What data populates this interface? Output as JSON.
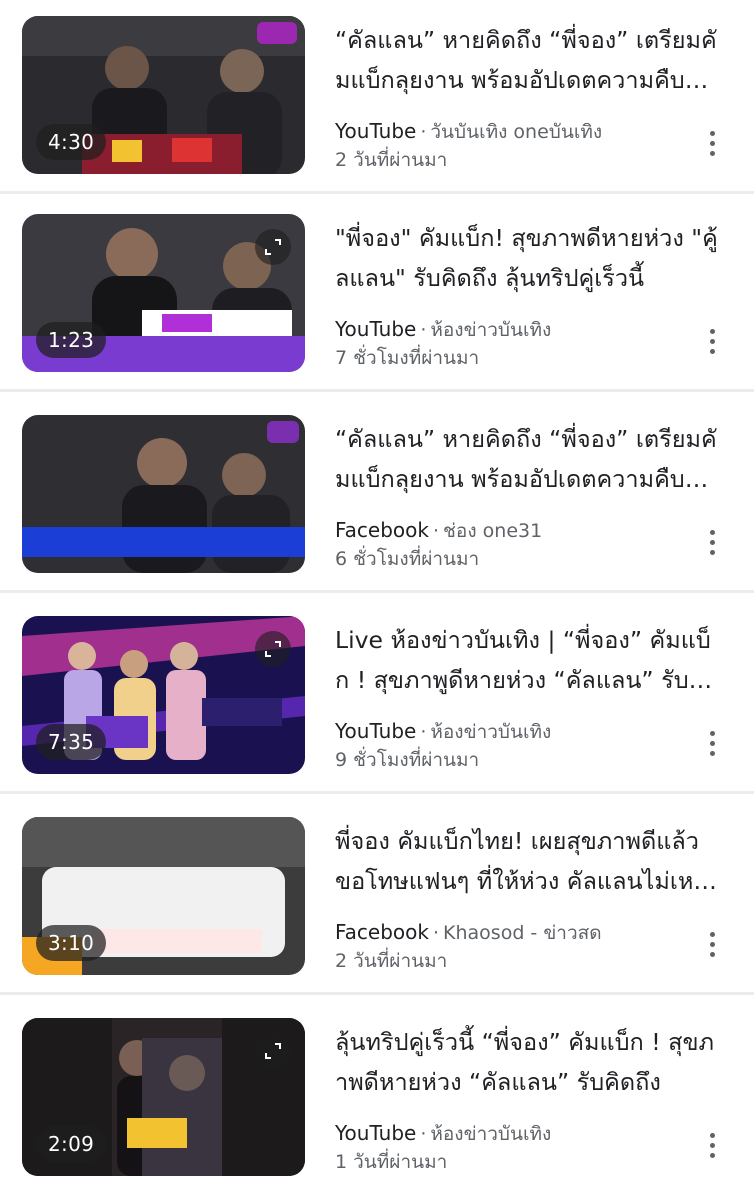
{
  "results": [
    {
      "title": "“คัลแลน” หายคิดถึง “พี่จอง” เตรียมคัมแบ็กลุยงาน พร้อมอัปเดตความคืบหน้า",
      "source": "YouTube",
      "channel": "วันบันเทิง oneบันเทิง",
      "time": "2 วันที่ผ่านมา",
      "duration": "4:30",
      "expand_icon": false,
      "thumb_colors": [
        "#2b2b2f",
        "#5a4d44",
        "#1c1c20"
      ]
    },
    {
      "title": "\"พี่จอง\" คัมแบ็ก! สุขภาพดีหายห่วง \"คู้ลแลน\" รับคิดถึง ลุ้นทริปคู่เร็วนี้",
      "source": "YouTube",
      "channel": "ห้องข่าวบันเทิง",
      "time": "7 ชั่วโมงที่ผ่านมา",
      "duration": "1:23",
      "expand_icon": true,
      "thumb_colors": [
        "#3a3a40",
        "#6b5f6a",
        "#7a3bd1"
      ]
    },
    {
      "title": "“คัลแลน” หายคิดถึง “พี่จอง” เตรียมคัมแบ็กลุยงาน พร้อมอัปเดตความคืบหน้า",
      "source": "Facebook",
      "channel": "ช่อง one31",
      "time": "6 ชั่วโมงที่ผ่านมา",
      "duration": "",
      "expand_icon": false,
      "thumb_colors": [
        "#2e2e33",
        "#57504c",
        "#1b3fd6"
      ]
    },
    {
      "title": "Live ห้องข่าวบันเทิง | “พี่จอง” คัมแบ็ก ! สุขภาพูดีหายห่วง “คัลแลน” รับคิดถึง",
      "source": "YouTube",
      "channel": "ห้องข่าวบันเทิง",
      "time": "9 ชั่วโมงที่ผ่านมา",
      "duration": "7:35",
      "expand_icon": true,
      "thumb_colors": [
        "#1a1250",
        "#c2379c",
        "#5b2ab8"
      ]
    },
    {
      "title": "พี่จอง คัมแบ็กไทย! เผยสุขภาพดีแล้ว ขอโทษแฟนๆ ที่ให้ห่วง คัลแลนไม่เหงาแล้ว",
      "source": "Facebook",
      "channel": "Khaosod - ข่าวสด",
      "time": "2 วันที่ผ่านมา",
      "duration": "3:10",
      "expand_icon": false,
      "thumb_colors": [
        "#3c3c3c",
        "#f1f1f1",
        "#f5a623"
      ]
    },
    {
      "title": "ลุ้นทริปคู่เร็วนี้ “พี่จอง” คัมแบ็ก ! สุขภาพดีหายห่วง “คัลแลน” รับคิดถึง",
      "source": "YouTube",
      "channel": "ห้องข่าวบันเทิง",
      "time": "1 วันที่ผ่านมา",
      "duration": "2:09",
      "expand_icon": true,
      "thumb_colors": [
        "#2a2426",
        "#6a5a55",
        "#1d1a1c"
      ]
    }
  ]
}
